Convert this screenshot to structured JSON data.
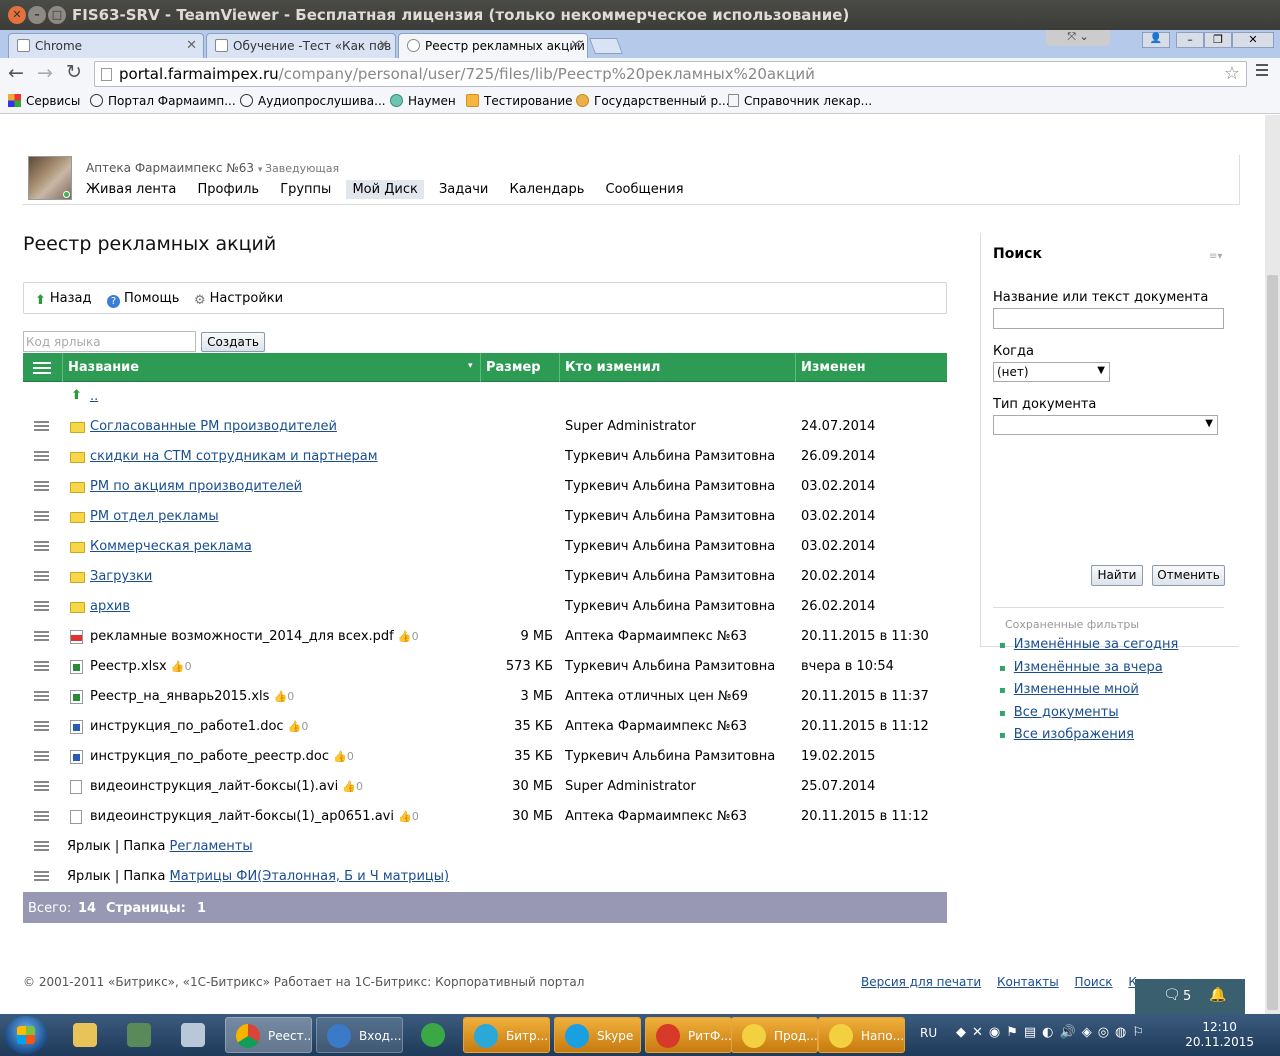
{
  "window": {
    "title": "FIS63-SRV - TeamViewer - Бесплатная лицензия (только некоммерческое использование)"
  },
  "tabs": [
    {
      "label": "Chrome"
    },
    {
      "label": "Обучение -Тест «Как пов"
    },
    {
      "label": "Реестр рекламных акций"
    }
  ],
  "address": {
    "host": "portal.farmaimpex.ru",
    "path": "/company/personal/user/725/files/lib/Реестр%20рекламных%20акций"
  },
  "bookmarks": [
    {
      "label": "Сервисы"
    },
    {
      "label": "Портал Фармаимп..."
    },
    {
      "label": "Аудиопрослушива..."
    },
    {
      "label": "Наумен"
    },
    {
      "label": "Тестирование"
    },
    {
      "label": "Государственный р..."
    },
    {
      "label": "Справочник лекар..."
    }
  ],
  "user": {
    "name": "Аптека Фармаимпекс №63",
    "role": "Заведующая",
    "nav": [
      {
        "label": "Живая лента"
      },
      {
        "label": "Профиль"
      },
      {
        "label": "Группы"
      },
      {
        "label": "Мой Диск"
      },
      {
        "label": "Задачи"
      },
      {
        "label": "Календарь"
      },
      {
        "label": "Сообщения"
      }
    ]
  },
  "page": {
    "title": "Реестр рекламных акций"
  },
  "actions": {
    "back": "Назад",
    "help": "Помощь",
    "settings": "Настройки"
  },
  "shortcut": {
    "placeholder": "Код ярлыка",
    "create": "Создать"
  },
  "grid": {
    "headers": {
      "name": "Название",
      "size": "Размер",
      "modified_by": "Кто изменил",
      "modified": "Изменен"
    },
    "up": "..",
    "rows": [
      {
        "type": "folder",
        "name": "Согласованные РМ производителей",
        "size": "",
        "who": "Super Administrator",
        "date": "24.07.2014"
      },
      {
        "type": "folder",
        "name": "скидки на СТМ сотрудникам и партнерам",
        "size": "",
        "who": "Туркевич Альбина Рамзитовна",
        "date": "26.09.2014"
      },
      {
        "type": "folder",
        "name": "РМ по акциям производителей",
        "size": "",
        "who": "Туркевич Альбина Рамзитовна",
        "date": "03.02.2014"
      },
      {
        "type": "folder",
        "name": "РМ отдел рекламы",
        "size": "",
        "who": "Туркевич Альбина Рамзитовна",
        "date": "03.02.2014"
      },
      {
        "type": "folder",
        "name": "Коммерческая реклама",
        "size": "",
        "who": "Туркевич Альбина Рамзитовна",
        "date": "03.02.2014"
      },
      {
        "type": "folder",
        "name": "Загрузки",
        "size": "",
        "who": "Туркевич Альбина Рамзитовна",
        "date": "20.02.2014"
      },
      {
        "type": "folder",
        "name": "архив",
        "size": "",
        "who": "Туркевич Альбина Рамзитовна",
        "date": "26.02.2014"
      },
      {
        "type": "pdf",
        "name": "рекламные возможности_2014_для всех.pdf",
        "likes": "0",
        "size": "9 МБ",
        "who": "Аптека Фармаимпекс №63",
        "date": "20.11.2015 в 11:30"
      },
      {
        "type": "xls",
        "name": "Реестр.xlsx",
        "likes": "0",
        "size": "573 КБ",
        "who": "Туркевич Альбина Рамзитовна",
        "date": "вчера в 10:54"
      },
      {
        "type": "xls",
        "name": "Реестр_на_январь2015.xls",
        "likes": "0",
        "size": "3 МБ",
        "who": "Аптека отличных цен №69",
        "date": "20.11.2015 в 11:37"
      },
      {
        "type": "doc",
        "name": "инструкция_по_работе1.doc",
        "likes": "0",
        "size": "35 КБ",
        "who": "Аптека Фармаимпекс №63",
        "date": "20.11.2015 в 11:12"
      },
      {
        "type": "doc",
        "name": "инструкция_по_работе_реестр.doc",
        "likes": "0",
        "size": "35 КБ",
        "who": "Туркевич Альбина Рамзитовна",
        "date": "19.02.2015"
      },
      {
        "type": "file",
        "name": "видеоинструкция_лайт-боксы(1).avi",
        "likes": "0",
        "size": "30 МБ",
        "who": "Super Administrator",
        "date": "25.07.2014"
      },
      {
        "type": "file",
        "name": "видеоинструкция_лайт-боксы(1)_ap0651.avi",
        "likes": "0",
        "size": "30 МБ",
        "who": "Аптека Фармаимпекс №63",
        "date": "20.11.2015 в 11:12"
      }
    ],
    "links": [
      {
        "prefix": "Ярлык | Папка ",
        "name": "Регламенты"
      },
      {
        "prefix": "Ярлык | Папка ",
        "name": "Матрицы ФИ(Эталонная, Б и Ч матрицы)"
      }
    ],
    "footer": {
      "total_label": "Всего:",
      "total": "14",
      "pages_label": "Страницы:",
      "pages": "1"
    }
  },
  "search": {
    "title": "Поиск",
    "name_label": "Название или текст документа",
    "when_label": "Когда",
    "when_value": "(нет)",
    "type_label": "Тип документа",
    "find": "Найти",
    "cancel": "Отменить",
    "saved_label": "Сохраненные фильтры",
    "saved": [
      {
        "label": "Изменённые за сегодня"
      },
      {
        "label": "Изменённые за вчера"
      },
      {
        "label": "Измененные мной"
      },
      {
        "label": "Все документы"
      },
      {
        "label": "Все изображения"
      }
    ]
  },
  "footer": {
    "copyright": "© 2001-2011 «Битрикс», «1С-Битрикс» Работает на 1С-Битрикс: Корпоративный портал",
    "print": "Версия для печати",
    "contacts": "Контакты",
    "search": "Поиск",
    "more": "К"
  },
  "chat": {
    "count": "5"
  },
  "taskbar": {
    "items": [
      {
        "label": "Реест..."
      },
      {
        "label": "Вход..."
      },
      {
        "label": "Битр..."
      },
      {
        "label": "Skype"
      },
      {
        "label": "РитФ..."
      },
      {
        "label": "Прод..."
      },
      {
        "label": "Напо..."
      }
    ],
    "lang": "RU",
    "time": "12:10",
    "date": "20.11.2015"
  },
  "colors": {
    "grid_header": "#2e9b55",
    "grid_footer": "#9898b5",
    "link": "#1a4e8f"
  }
}
